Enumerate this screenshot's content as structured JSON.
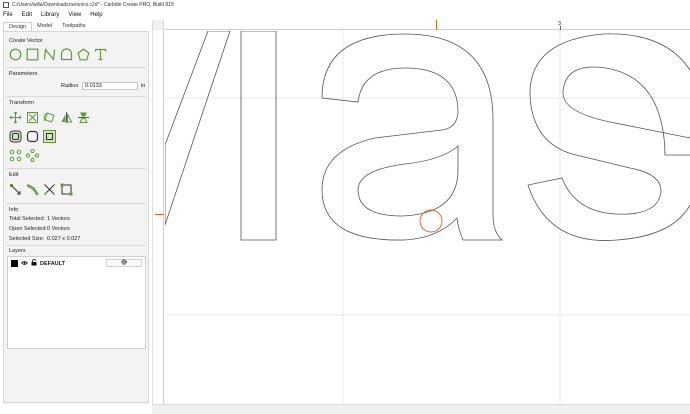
{
  "window": {
    "title": "C:/Users/willa/Downloads/avionics.c2d* - Carbide Create PRO, Build 815"
  },
  "menu": [
    "File",
    "Edit",
    "Library",
    "View",
    "Help"
  ],
  "tabs": [
    "Design",
    "Model",
    "Toolpaths"
  ],
  "create_vector": {
    "title": "Create Vector",
    "tools": [
      "circle-icon",
      "rectangle-icon",
      "polyline-icon",
      "arch-icon",
      "polygon-icon",
      "text-icon"
    ]
  },
  "parameters": {
    "title": "Parameters",
    "radius_label": "Radius",
    "radius_value": "0.0133",
    "unit": "in"
  },
  "transform": {
    "title": "Transform"
  },
  "edit": {
    "title": "Edit"
  },
  "info": {
    "title": "Info",
    "rows": [
      {
        "label": "Total Selected:",
        "value": "1 Vectors"
      },
      {
        "label": "Open Selected:",
        "value": "0 Vectors"
      },
      {
        "label": "Selected Size:",
        "value": "0.027 x 0.027"
      }
    ]
  },
  "layers": {
    "title": "Layers",
    "items": [
      {
        "name": "DEFAULT"
      }
    ]
  },
  "ruler": {
    "top_label": "3"
  },
  "colors": {
    "accent_green": "#5aa02c",
    "selection_orange": "#e2621b",
    "vector_stroke": "#555555"
  }
}
